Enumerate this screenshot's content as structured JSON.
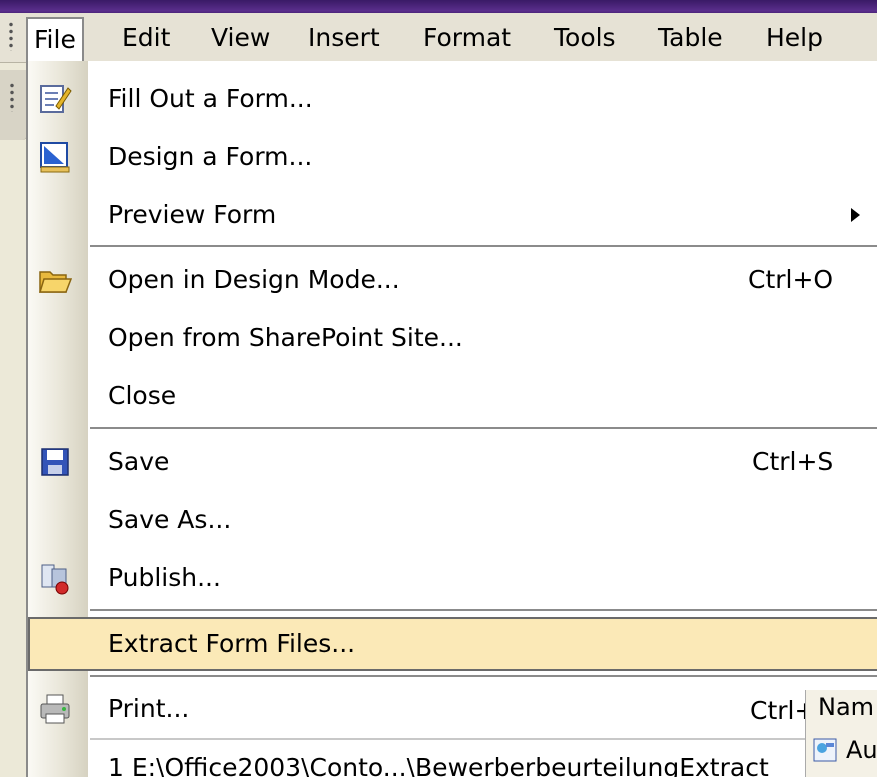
{
  "menubar": {
    "menus": [
      "File",
      "Edit",
      "View",
      "Insert",
      "Format",
      "Tools",
      "Table",
      "Help"
    ]
  },
  "file_menu": {
    "items": [
      {
        "label": "Fill Out a Form...",
        "shortcut": "",
        "icon": "fill-out-form-icon"
      },
      {
        "label": "Design a Form...",
        "shortcut": "",
        "icon": "design-form-icon"
      },
      {
        "label": "Preview Form",
        "shortcut": "",
        "icon": ""
      },
      {
        "label": "Open in Design Mode...",
        "shortcut": "Ctrl+O",
        "icon": "open-folder-icon"
      },
      {
        "label": "Open from SharePoint Site...",
        "shortcut": "",
        "icon": ""
      },
      {
        "label": "Close",
        "shortcut": "",
        "icon": ""
      },
      {
        "label": "Save",
        "shortcut": "Ctrl+S",
        "icon": "save-floppy-icon"
      },
      {
        "label": "Save As...",
        "shortcut": "",
        "icon": ""
      },
      {
        "label": "Publish...",
        "shortcut": "",
        "icon": "publish-icon"
      },
      {
        "label": "Extract Form Files...",
        "shortcut": "",
        "icon": ""
      },
      {
        "label": "Print...",
        "shortcut": "Ctrl+",
        "icon": "printer-icon"
      }
    ],
    "recent_file": "1 E:\\Office2003\\Conto...\\BewerberbeurteilungExtract"
  },
  "right_panel": {
    "header": "Nam",
    "item_text": "Au"
  },
  "colors": {
    "selected_bg": "#fbe9b7",
    "menu_bg": "#ffffff",
    "title_bar": "#3a1a66"
  }
}
